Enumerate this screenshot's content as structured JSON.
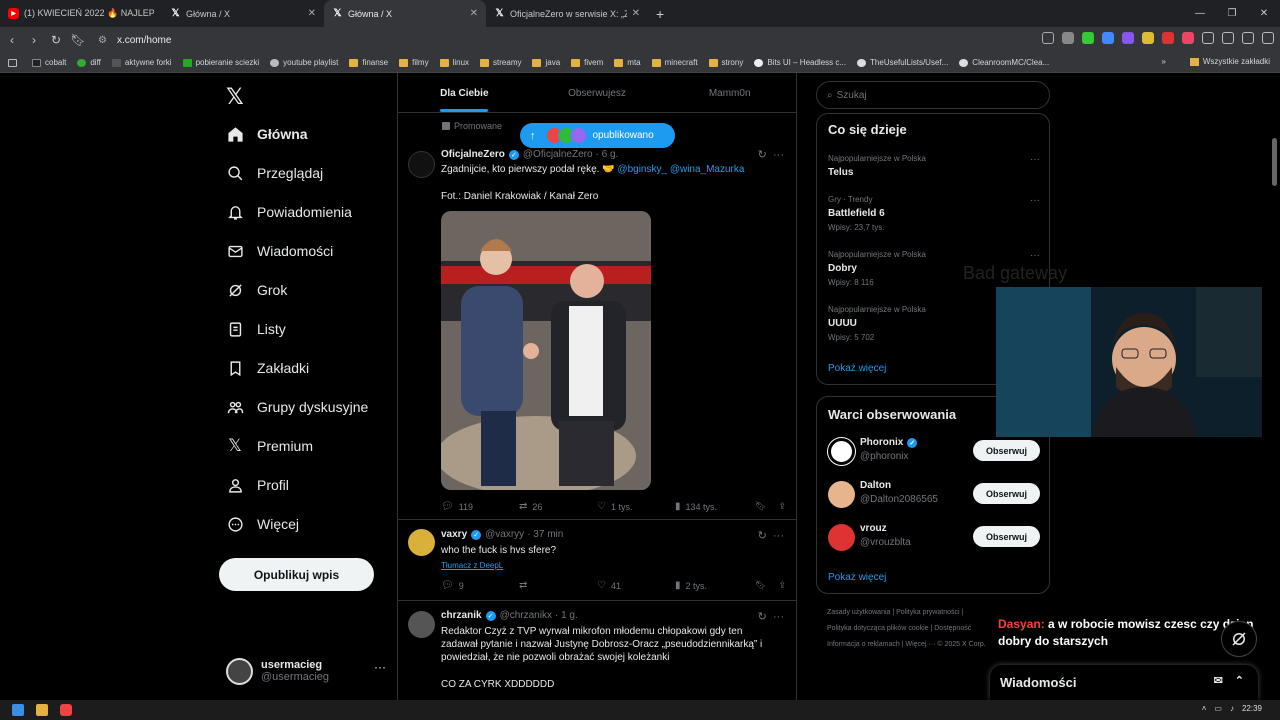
{
  "browser": {
    "tabs": [
      {
        "title": "(1) KWIECIEŃ 2022 🔥 NAJLEPSZ...",
        "icon": "youtube-icon",
        "active": false
      },
      {
        "title": "Główna / X",
        "icon": "x-icon",
        "active": false
      },
      {
        "title": "Główna / X",
        "icon": "x-icon",
        "active": true
      },
      {
        "title": "OficjalneZero w serwisie X: „Zga...",
        "icon": "x-icon",
        "active": false
      }
    ],
    "url": "x.com/home",
    "bookmarks": [
      "cobalt",
      "diff",
      "aktywne forki",
      "pobieranie sciezki",
      "youtube playlist",
      "finanse",
      "filmy",
      "linux",
      "streamy",
      "java",
      "fivem",
      "mta",
      "minecraft",
      "strony",
      "Bits UI – Headless c...",
      "TheUsefulLists/Usef...",
      "CleanroomMC/Clea..."
    ],
    "bookmarks_folder_right": "Wszystkie zakładki"
  },
  "sidebar": {
    "items": [
      {
        "label": "Główna",
        "icon": "home-icon"
      },
      {
        "label": "Przeglądaj",
        "icon": "search-icon"
      },
      {
        "label": "Powiadomienia",
        "icon": "bell-icon"
      },
      {
        "label": "Wiadomości",
        "icon": "mail-icon"
      },
      {
        "label": "Grok",
        "icon": "grok-icon"
      },
      {
        "label": "Listy",
        "icon": "list-icon"
      },
      {
        "label": "Zakładki",
        "icon": "bookmark-icon"
      },
      {
        "label": "Grupy dyskusyjne",
        "icon": "people-icon"
      },
      {
        "label": "Premium",
        "icon": "x-icon"
      },
      {
        "label": "Profil",
        "icon": "person-icon"
      },
      {
        "label": "Więcej",
        "icon": "more-icon"
      }
    ],
    "post_button": "Opublikuj wpis",
    "account": {
      "name": "usermacieg",
      "handle": "@usermacieg"
    }
  },
  "feed": {
    "tabs": [
      "Dla Ciebie",
      "Obserwujesz",
      "Mamm0n"
    ],
    "promoted_label": "Promowane",
    "new_posts_pill": "opublikowano",
    "tweets": [
      {
        "name": "OficjalneZero",
        "handle": "@OficjalneZero",
        "time": "· 6 g.",
        "text": "Zgadnijcie, kto pierwszy podał rękę. 🤝",
        "mentions": "@bginsky_ @wina_Mazurka",
        "text2": "Fot.: Daniel Krakowiak / Kanał Zero",
        "replies": "119",
        "reposts": "26",
        "likes": "1 tys.",
        "views": "134 tys."
      },
      {
        "name": "vaxry",
        "handle": "@vaxryy",
        "time": "· 37 min",
        "text": "who the fuck is hvs sfere?",
        "translate": "Tłumacz z DeepL",
        "replies": "9",
        "reposts": "",
        "likes": "41",
        "views": "2 tys."
      },
      {
        "name": "chrzanik",
        "handle": "@chrzanikx",
        "time": "· 1 g.",
        "text": "Redaktor Czyż z TVP wyrwał mikrofon młodemu chłopakowi gdy ten zadawał pytanie i nazwał Justynę Dobrosz-Oracz „pseudodziennikarką” i powiedział, że nie pozwoli obrażać swojej koleżanki",
        "text2": "CO ZA CYRK XDDDDDD"
      }
    ]
  },
  "right": {
    "search_placeholder": "Szukaj",
    "trends_title": "Co się dzieje",
    "trends": [
      {
        "meta": "Najpopularniejsze w Polska",
        "title": "Telus",
        "count": ""
      },
      {
        "meta": "Gry · Trendy",
        "title": "Battlefield 6",
        "count": "Wpisy: 23,7 tys."
      },
      {
        "meta": "Najpopularniejsze w Polska",
        "title": "Dobry",
        "count": "Wpisy: 8 116"
      },
      {
        "meta": "Najpopularniejsze w Polska",
        "title": "UUUU",
        "count": "Wpisy: 5 702"
      }
    ],
    "show_more": "Pokaż więcej",
    "follow_title": "Warci obserwowania",
    "follow": [
      {
        "name": "Phoronix",
        "handle": "@phoronix",
        "verified": true
      },
      {
        "name": "Dalton",
        "handle": "@Dalton2086565",
        "verified": false
      },
      {
        "name": "vrouz",
        "handle": "@vrouzblta",
        "verified": false
      }
    ],
    "follow_button": "Obserwuj",
    "footer_1": "Zasady użytkowania  |  Polityka prywatności  |",
    "footer_2": "Polityka dotycząca plików cookie  |  Dostępność",
    "footer_3": "Informacja o reklamach  |  Więcej ···  © 2025 X Corp."
  },
  "overlay": {
    "bad_gateway": "Bad gateway",
    "chat_user": "Dasyan:",
    "chat_text": "a w robocie mowisz czesc czy dzien dobry do starszych",
    "messages_label": "Wiadomości"
  },
  "taskbar": {
    "time": "22:39"
  },
  "colors": {
    "accent": "#1d9bf0",
    "bg": "#000000",
    "muted": "#71767b"
  }
}
